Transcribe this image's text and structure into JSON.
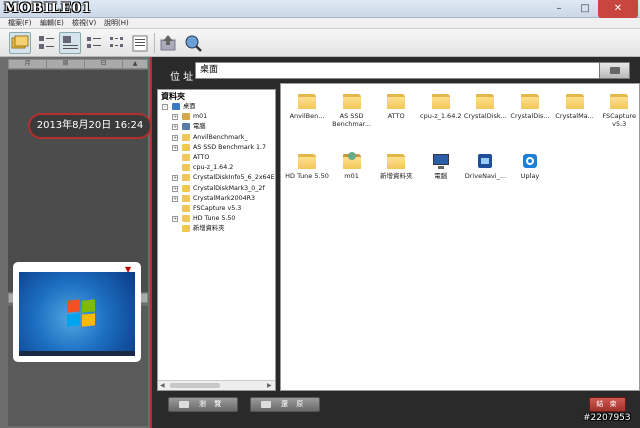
{
  "window": {
    "logo": "MOBILE01",
    "minimize": "–",
    "maximize": "□",
    "close": "✕"
  },
  "menu": [
    "檔案(F)",
    "編輯(E)",
    "檢視(V)",
    "說明(H)"
  ],
  "left_panel": {
    "calendar_top": [
      "月",
      "周",
      "日",
      "▲"
    ],
    "calendar_bottom": [
      "月",
      "周",
      "日",
      "▼"
    ],
    "date_time": "2013年8月20日  16:24"
  },
  "address": {
    "label": "位 址",
    "value": "桌面"
  },
  "tree": {
    "header": "資料夾",
    "items": [
      {
        "label": "桌面",
        "icon": "desktop-icon",
        "level": 0,
        "expander": "-"
      },
      {
        "label": "m01",
        "icon": "user-folder-icon",
        "level": 1,
        "expander": "+"
      },
      {
        "label": "電腦",
        "icon": "computer-icon",
        "level": 1,
        "expander": "+"
      },
      {
        "label": "AnvilBenchmark_",
        "icon": "folder-icon",
        "level": 1,
        "expander": "+"
      },
      {
        "label": "AS SSD Benchmark 1.7",
        "icon": "folder-icon",
        "level": 1,
        "expander": "+"
      },
      {
        "label": "ATTO",
        "icon": "folder-icon",
        "level": 1,
        "expander": ""
      },
      {
        "label": "cpu-z_1.64.2",
        "icon": "folder-icon",
        "level": 1,
        "expander": ""
      },
      {
        "label": "CrystalDiskInfo5_6_2x64E",
        "icon": "folder-icon",
        "level": 1,
        "expander": "+"
      },
      {
        "label": "CrystalDiskMark3_0_2f",
        "icon": "folder-icon",
        "level": 1,
        "expander": "+"
      },
      {
        "label": "CrystalMark2004R3",
        "icon": "folder-icon",
        "level": 1,
        "expander": "+"
      },
      {
        "label": "FSCapture v5.3",
        "icon": "folder-icon",
        "level": 1,
        "expander": ""
      },
      {
        "label": "HD Tune 5.50",
        "icon": "folder-icon",
        "level": 1,
        "expander": "+"
      },
      {
        "label": "新增資料夾",
        "icon": "folder-icon",
        "level": 1,
        "expander": ""
      }
    ],
    "scroll_left": "◀",
    "scroll_right": "▶"
  },
  "files": [
    {
      "label": "AnvilBen...",
      "icon": "folder-icon"
    },
    {
      "label": "AS SSD Benchmar...",
      "icon": "folder-icon"
    },
    {
      "label": "ATTO",
      "icon": "folder-icon"
    },
    {
      "label": "cpu-z_1.64.2",
      "icon": "folder-icon"
    },
    {
      "label": "CrystalDisk...",
      "icon": "folder-icon"
    },
    {
      "label": "CrystalDis...",
      "icon": "folder-icon"
    },
    {
      "label": "CrystalMa...",
      "icon": "folder-icon"
    },
    {
      "label": "FSCapture v5.3",
      "icon": "folder-icon"
    },
    {
      "label": "HD Tune 5.50",
      "icon": "folder-icon"
    },
    {
      "label": "m01",
      "icon": "user-folder-icon"
    },
    {
      "label": "新增資料夾",
      "icon": "folder-icon"
    },
    {
      "label": "電腦",
      "icon": "computer-icon"
    },
    {
      "label": "DriveNavi_...",
      "icon": "shortcut-app-icon"
    },
    {
      "label": "Uplay",
      "icon": "uplay-icon"
    }
  ],
  "buttons": {
    "browse": "瀏 覽",
    "restore": "還 原",
    "close": "結 束"
  },
  "watermark": "#2207953",
  "colors": {
    "accent": "#b03030",
    "panel_dark": "#2a2a2a",
    "folder": "#f2c75a"
  }
}
